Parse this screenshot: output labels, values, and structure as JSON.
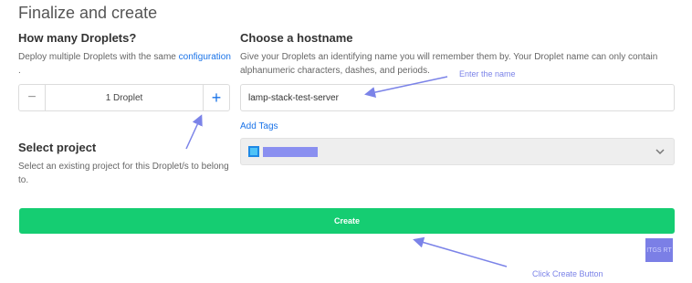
{
  "page": {
    "title": "Finalize and create"
  },
  "droplets": {
    "heading": "How many Droplets?",
    "description_prefix": "Deploy multiple Droplets with the same",
    "description_link": "configuration",
    "description_suffix": ".",
    "minus_label": "−",
    "plus_label": "+",
    "count_text": "1  Droplet"
  },
  "hostname": {
    "heading": "Choose a hostname",
    "description": "Give your Droplets an identifying name you will remember them by. Your Droplet name can only contain alphanumeric characters, dashes, and periods.",
    "value": "lamp-stack-test-server",
    "add_tags_label": "Add Tags"
  },
  "project": {
    "heading": "Select project",
    "description": "Select an existing project for this Droplet/s to belong to."
  },
  "create_button": {
    "label": "Create"
  },
  "annotations": {
    "enter_name": "Enter the name",
    "click_create": "Click Create Button",
    "logo_text": "ITGS RT"
  },
  "colors": {
    "create_green": "#15cd72",
    "link_blue": "#1a73e8",
    "annotation_purple": "#7b83e8"
  }
}
